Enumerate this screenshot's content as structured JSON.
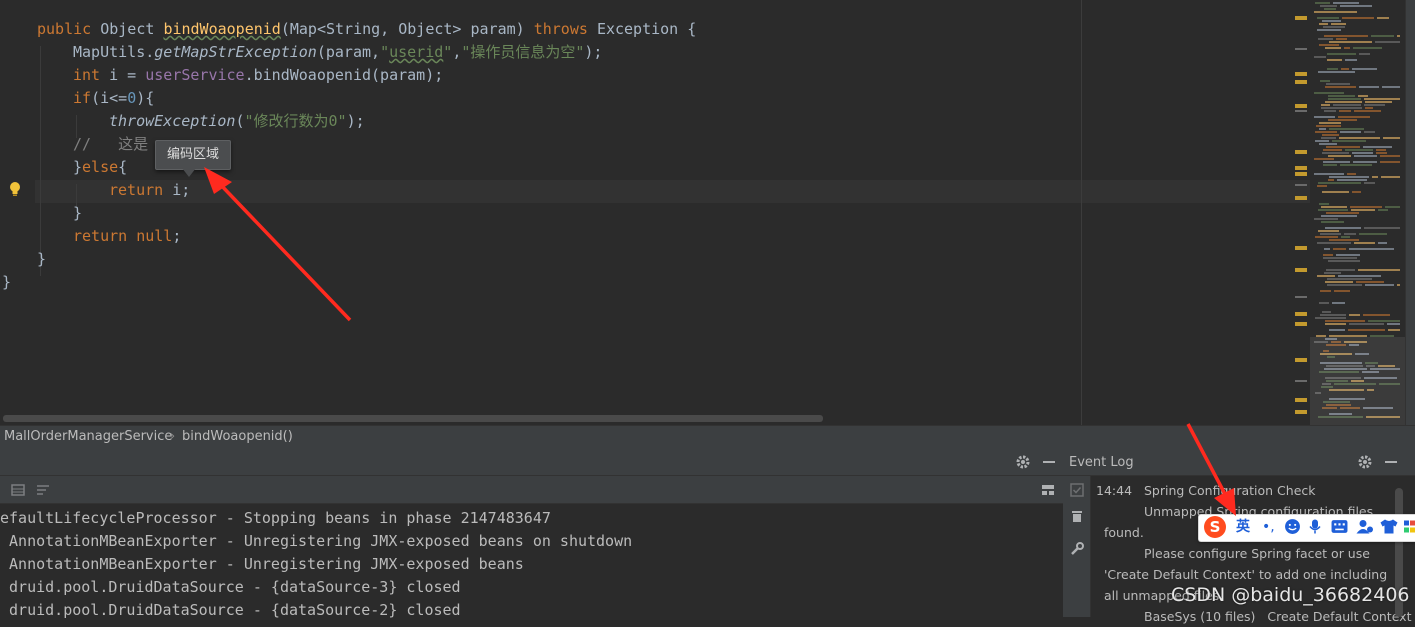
{
  "editor": {
    "lines": [
      {
        "indent": 1,
        "tokens": [
          {
            "t": "public ",
            "c": "kw"
          },
          {
            "t": "Object ",
            "c": ""
          },
          {
            "t": "bindWoaopenid",
            "c": "fn und"
          },
          {
            "t": "(Map<String, Object> param) ",
            "c": ""
          },
          {
            "t": "throws ",
            "c": "kw"
          },
          {
            "t": "Exception {",
            "c": ""
          }
        ]
      },
      {
        "indent": 2,
        "tokens": [
          {
            "t": "MapUtils.",
            "c": ""
          },
          {
            "t": "getMapStrException",
            "c": "it"
          },
          {
            "t": "(param,",
            "c": ""
          },
          {
            "t": "\"",
            "c": "str"
          },
          {
            "t": "userid",
            "c": "str und"
          },
          {
            "t": "\"",
            "c": "str"
          },
          {
            "t": ",",
            "c": ""
          },
          {
            "t": "\"操作员信息为空\"",
            "c": "str"
          },
          {
            "t": ");",
            "c": ""
          }
        ]
      },
      {
        "indent": 2,
        "tokens": [
          {
            "t": "int ",
            "c": "kw"
          },
          {
            "t": "i = ",
            "c": ""
          },
          {
            "t": "userService",
            "c": "fld"
          },
          {
            "t": ".bindWoaopenid(param);",
            "c": ""
          }
        ]
      },
      {
        "indent": 2,
        "tokens": [
          {
            "t": "if",
            "c": "kw"
          },
          {
            "t": "(i<=",
            "c": ""
          },
          {
            "t": "0",
            "c": "num"
          },
          {
            "t": "){",
            "c": ""
          }
        ]
      },
      {
        "indent": 3,
        "tokens": [
          {
            "t": "throwException",
            "c": "it"
          },
          {
            "t": "(",
            "c": ""
          },
          {
            "t": "\"修改行数为0\"",
            "c": "str"
          },
          {
            "t": ");",
            "c": ""
          }
        ]
      },
      {
        "indent": 2,
        "tokens": [
          {
            "t": "//   这是",
            "c": "cm"
          }
        ]
      },
      {
        "indent": 2,
        "tokens": [
          {
            "t": "}",
            "c": ""
          },
          {
            "t": "else",
            "c": "kw"
          },
          {
            "t": "{",
            "c": ""
          }
        ]
      },
      {
        "indent": 3,
        "tokens": [
          {
            "t": "return ",
            "c": "kw"
          },
          {
            "t": "i;",
            "c": ""
          }
        ]
      },
      {
        "indent": 2,
        "tokens": [
          {
            "t": "}",
            "c": ""
          }
        ]
      },
      {
        "indent": 2,
        "tokens": [
          {
            "t": "return null",
            "c": "kw"
          },
          {
            "t": ";",
            "c": ""
          }
        ]
      },
      {
        "indent": 1,
        "tokens": [
          {
            "t": "}",
            "c": ""
          }
        ]
      },
      {
        "indent": 0,
        "tokens": [
          {
            "t": "}",
            "c": ""
          }
        ]
      }
    ],
    "tooltip": "编码区域"
  },
  "breadcrumb": {
    "class_name": "MallOrderManagerService",
    "method_name": "bindWoaopenid()"
  },
  "console": {
    "lines": [
      "efaultLifecycleProcessor - Stopping beans in phase 2147483647",
      " AnnotationMBeanExporter - Unregistering JMX-exposed beans on shutdown",
      " AnnotationMBeanExporter - Unregistering JMX-exposed beans",
      " druid.pool.DruidDataSource - {dataSource-3} closed",
      " druid.pool.DruidDataSource - {dataSource-2} closed"
    ]
  },
  "event_log": {
    "title": "Event Log",
    "time": "14:44",
    "entry_title": "Spring Configuration Check",
    "lines": [
      "Unmapped Spring configuration files",
      "found.",
      "Please configure Spring facet or use",
      "'Create Default Context' to add one including",
      "all unmapped files.",
      "BaseSys (10 files)   Create Default Context"
    ]
  },
  "ime": {
    "logo": "S",
    "language": "英",
    "punct": "•,"
  },
  "watermark": "CSDN @baidu_36682406",
  "colors": {
    "editor_bg": "#2b2b2b",
    "keyword": "#cc7832",
    "method": "#ffc66d",
    "string": "#6a8759",
    "number": "#6897bb",
    "field": "#9876aa",
    "arrow": "#ff2a1f",
    "ime_accent": "#1f5fd8"
  }
}
